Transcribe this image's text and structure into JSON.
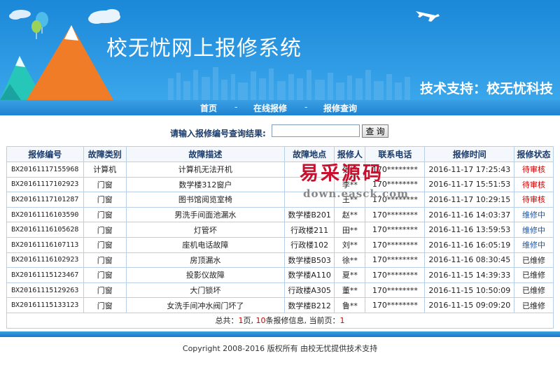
{
  "header": {
    "title": "校无忧网上报修系统",
    "support": "技术支持：校无忧科技"
  },
  "nav": {
    "items": [
      {
        "label": "首页"
      },
      {
        "label": "在线报修"
      },
      {
        "label": "报修查询"
      }
    ],
    "separator": "-"
  },
  "search": {
    "label": "请输入报修编号查询结果:",
    "value": "",
    "button": "查 询"
  },
  "table": {
    "headers": [
      "报修编号",
      "故障类别",
      "故障描述",
      "故障地点",
      "报修人",
      "联系电话",
      "报修时间",
      "报修状态"
    ],
    "rows": [
      {
        "id": "BX20161117155968",
        "category": "计算机",
        "desc": "计算机无法开机",
        "location": "",
        "person": "张**",
        "phone": "170********",
        "time": "2016-11-17 17:25:43",
        "status": "待审核",
        "status_type": "pending"
      },
      {
        "id": "BX20161117102923",
        "category": "门窗",
        "desc": "数学楼312窗户",
        "location": "",
        "person": "李**",
        "phone": "170********",
        "time": "2016-11-17 15:51:53",
        "status": "待审核",
        "status_type": "pending"
      },
      {
        "id": "BX20161117101287",
        "category": "门窗",
        "desc": "图书馆阅览室椅",
        "location": "",
        "person": "王**",
        "phone": "170********",
        "time": "2016-11-17 10:29:15",
        "status": "待审核",
        "status_type": "pending"
      },
      {
        "id": "BX20161116103590",
        "category": "门窗",
        "desc": "男洗手间面池漏水",
        "location": "数学楼B201",
        "person": "赵**",
        "phone": "170********",
        "time": "2016-11-16 14:03:37",
        "status": "维修中",
        "status_type": "repairing"
      },
      {
        "id": "BX20161116105628",
        "category": "门窗",
        "desc": "灯管坏",
        "location": "行政楼211",
        "person": "田**",
        "phone": "170********",
        "time": "2016-11-16 13:59:53",
        "status": "维修中",
        "status_type": "repairing"
      },
      {
        "id": "BX20161116107113",
        "category": "门窗",
        "desc": "座机电话故障",
        "location": "行政楼102",
        "person": "刘**",
        "phone": "170********",
        "time": "2016-11-16 16:05:19",
        "status": "维修中",
        "status_type": "repairing"
      },
      {
        "id": "BX20161116102923",
        "category": "门窗",
        "desc": "房顶漏水",
        "location": "数学楼B503",
        "person": "徐**",
        "phone": "170********",
        "time": "2016-11-16 08:30:45",
        "status": "已维修",
        "status_type": "done"
      },
      {
        "id": "BX20161115123467",
        "category": "门窗",
        "desc": "投影仪故障",
        "location": "数学楼A110",
        "person": "夏**",
        "phone": "170********",
        "time": "2016-11-15 14:39:33",
        "status": "已维修",
        "status_type": "done"
      },
      {
        "id": "BX20161115129263",
        "category": "门窗",
        "desc": "大门锁坏",
        "location": "行政楼A305",
        "person": "董**",
        "phone": "170********",
        "time": "2016-11-15 10:50:09",
        "status": "已维修",
        "status_type": "done"
      },
      {
        "id": "BX20161115133123",
        "category": "门窗",
        "desc": "女洗手间冲水阀门坏了",
        "location": "数学楼B212",
        "person": "鲁**",
        "phone": "170********",
        "time": "2016-11-15 09:09:20",
        "status": "已维修",
        "status_type": "done"
      }
    ],
    "summary": {
      "prefix": "总共：",
      "total_pages": "1",
      "mid1": "页, ",
      "total_records": "10",
      "mid2": "条报修信息, 当前页：",
      "current_page": "1"
    }
  },
  "watermark": {
    "main": "易采源码",
    "sub": "down.easck.com"
  },
  "footer": {
    "text": "Copyright 2008-2016 版权所有 由校无忧提供技术支持"
  },
  "colors": {
    "header_blue": "#2c98e3",
    "pending": "#cc0000",
    "repairing": "#1a55a8",
    "watermark": "#c8102e"
  }
}
